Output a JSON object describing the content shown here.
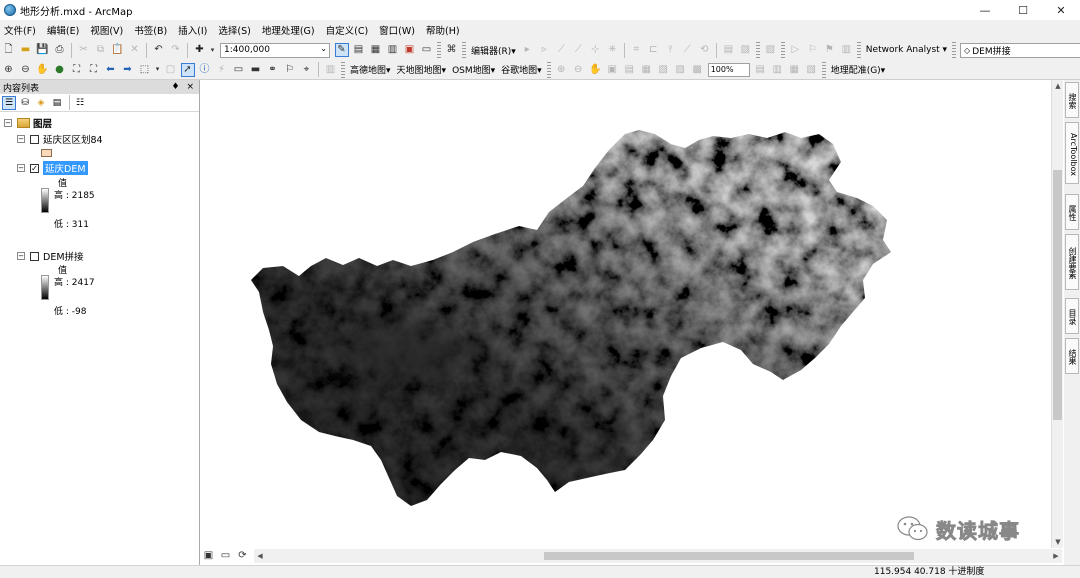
{
  "window": {
    "title": "地形分析.mxd - ArcMap",
    "controls": [
      "—",
      "☐",
      "✕"
    ]
  },
  "menu": [
    "文件(F)",
    "编辑(E)",
    "视图(V)",
    "书签(B)",
    "插入(I)",
    "选择(S)",
    "地理处理(G)",
    "自定义(C)",
    "窗口(W)",
    "帮助(H)"
  ],
  "toolbar1": {
    "scale": "1:400,000",
    "editor_label": "编辑器(R)▾",
    "network_label": "Network Analyst ▾",
    "layer_select": "DEM拼接"
  },
  "toolbar2": {
    "basemaps": [
      "高德地图▾",
      "天地图地图▾",
      "OSM地图▾",
      "谷歌地图▾"
    ],
    "zoom_percent": "100%",
    "georef_label": "地理配准(G)▾"
  },
  "toc": {
    "title": "内容列表",
    "pins": "♦ ×",
    "root": "图层",
    "layers": [
      {
        "name": "延庆区区划84",
        "checked": false
      },
      {
        "name": "延庆DEM",
        "checked": true,
        "legend_title": "值",
        "high": "高 : 2185",
        "low": "低 : 311"
      },
      {
        "name": "DEM拼接",
        "checked": false,
        "legend_title": "值",
        "high": "高 : 2417",
        "low": "低 : -98"
      }
    ]
  },
  "status": {
    "coordinates": "115.954  40.718 十进制度"
  },
  "right_dock": [
    "搜索",
    "ArcToolbox",
    "属性",
    "创建要素",
    "目录",
    "结果"
  ],
  "watermark": "数读城事",
  "colors": {
    "selection": "#3399ff",
    "chrome": "#f0f0f0"
  }
}
